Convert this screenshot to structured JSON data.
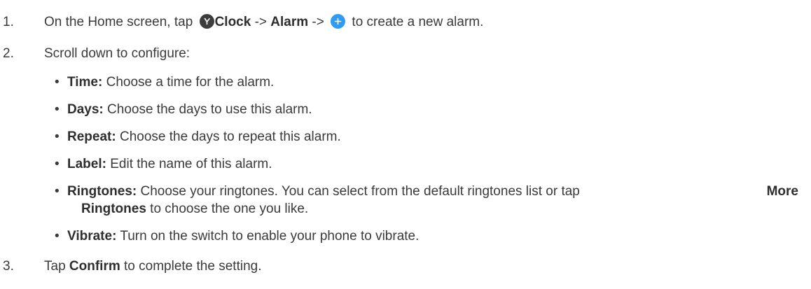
{
  "steps": [
    {
      "number": "1.",
      "prefix": "On the Home screen, tap ",
      "clock_label": "Clock",
      "sep1": " -> ",
      "alarm_label": "Alarm",
      "sep2": " -> ",
      "suffix": " to create a new alarm.",
      "icons": [
        "clock-icon",
        "plus-icon"
      ]
    },
    {
      "number": "2.",
      "text": "Scroll down to configure:"
    },
    {
      "number": "3.",
      "prefix": "Tap ",
      "bold": "Confirm",
      "suffix": " to complete the setting."
    }
  ],
  "bullets": [
    {
      "bullet": "•",
      "term": "Time:",
      "desc": " Choose a time for the alarm."
    },
    {
      "bullet": "•",
      "term": "Days:",
      "desc": " Choose the days to use this alarm."
    },
    {
      "bullet": "•",
      "term": "Repeat:",
      "desc": " Choose the days to repeat this alarm."
    },
    {
      "bullet": "•",
      "term": "Label:",
      "desc": " Edit the name of this alarm."
    },
    {
      "bullet": "•",
      "term": "Ringtones:",
      "desc": " Choose your ringtones. You can select from the default ringtones list or tap",
      "bold_end": "More",
      "cont_bold": "Ringtones",
      "cont_text": " to choose the one you like."
    },
    {
      "bullet": "•",
      "term": "Vibrate:",
      "desc": " Turn on the switch to enable your phone to vibrate."
    }
  ],
  "colors": {
    "text": "#3a3a3a",
    "clock_icon": "#3c3c3c",
    "plus_icon": "#2f9bf3"
  }
}
